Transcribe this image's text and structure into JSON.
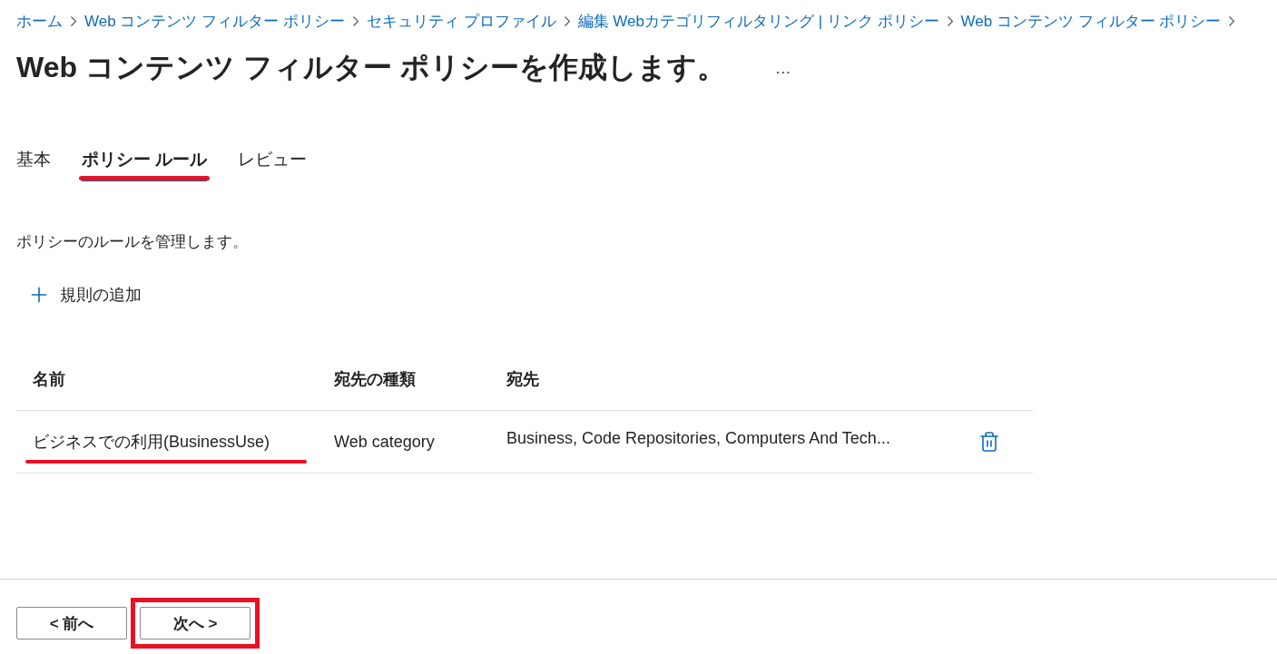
{
  "breadcrumb": [
    "ホーム",
    "Web コンテンツ フィルター ポリシー",
    "セキュリティ プロファイル",
    "編集 Webカテゴリフィルタリング | リンク ポリシー",
    "Web コンテンツ フィルター ポリシー"
  ],
  "title": "Web コンテンツ フィルター ポリシーを作成します。",
  "more": "…",
  "tabs": [
    {
      "label": "基本",
      "selected": false,
      "annotated": false
    },
    {
      "label": "ポリシー ルール",
      "selected": true,
      "annotated": true
    },
    {
      "label": "レビュー",
      "selected": false,
      "annotated": false
    }
  ],
  "description": "ポリシーのルールを管理します。",
  "add_rule": "規則の追加",
  "table": {
    "columns": [
      "名前",
      "宛先の種類",
      "宛先"
    ],
    "rows": [
      {
        "name": "ビジネスでの利用(BusinessUse)",
        "destination_type": "Web category",
        "destination": "Business, Code Repositories, Computers And Tech...",
        "annotated": true
      }
    ]
  },
  "footer": {
    "buttons": [
      {
        "label": "< 前へ",
        "annotated": false
      },
      {
        "label": "次へ >",
        "annotated": true
      }
    ]
  }
}
